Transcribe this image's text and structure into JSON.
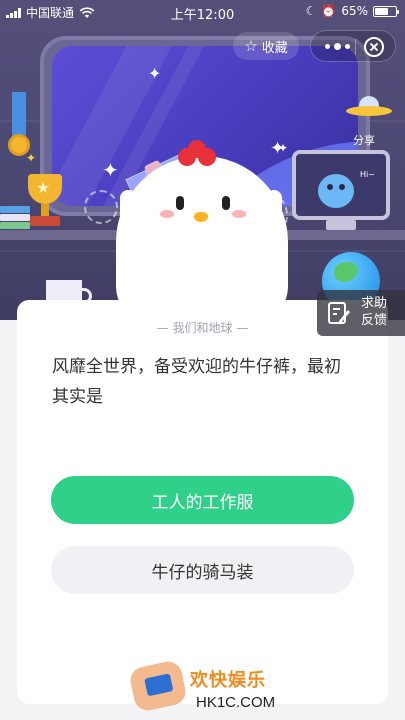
{
  "status_bar": {
    "carrier": "中国联通",
    "time": "上午12:00",
    "battery": "65%",
    "battery_level": 0.65
  },
  "toolbar": {
    "favorite_label": "收藏",
    "share_label": "分享"
  },
  "help": {
    "line1": "求助",
    "line2": "反馈"
  },
  "card": {
    "category": "— 我们和地球 —",
    "question": "风靡全世界，备受欢迎的牛仔裤，最初其实是",
    "options": [
      {
        "label": "工人的工作服",
        "selected": true
      },
      {
        "label": "牛仔的骑马装",
        "selected": false
      }
    ]
  },
  "scene": {
    "monitor_text": "Hi~"
  },
  "watermark": {
    "title": "欢快娱乐",
    "url": "HK1C.COM"
  },
  "colors": {
    "scene_bg": "#4b4873",
    "option_primary": "#2fd08a",
    "option_secondary": "#f0f1f5",
    "text_primary": "#333333"
  }
}
